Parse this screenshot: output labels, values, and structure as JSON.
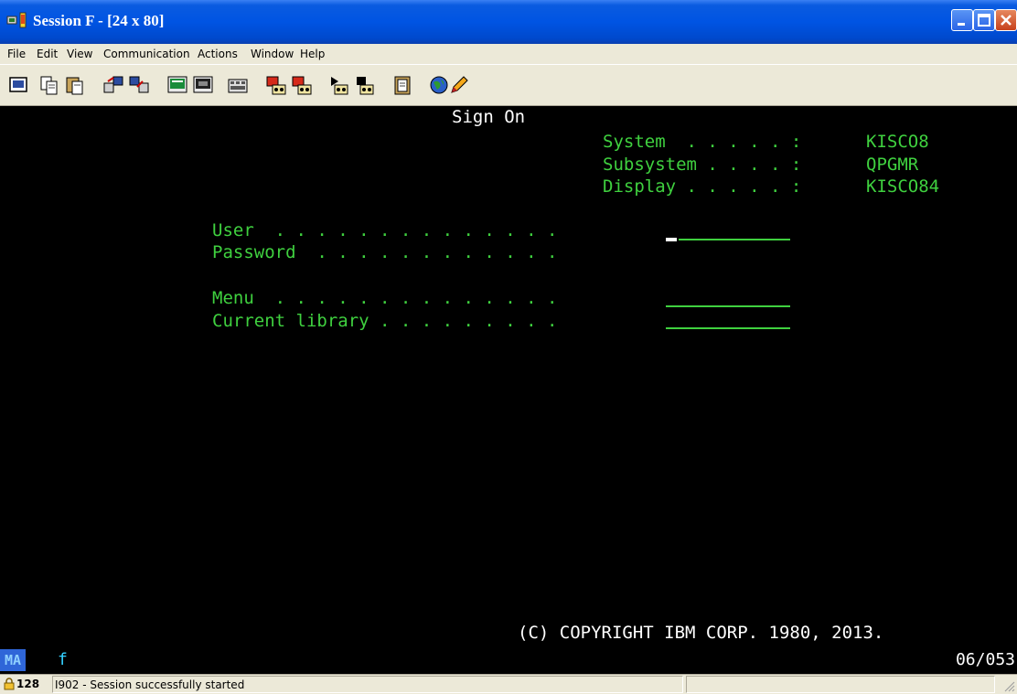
{
  "window": {
    "title": "Session F - [24 x 80]"
  },
  "menu": {
    "items": [
      "File",
      "Edit",
      "View",
      "Communication",
      "Actions",
      "Window",
      "Help"
    ]
  },
  "toolbar": {
    "icons": [
      "print-screen-icon",
      "copy-icon",
      "paste-icon",
      "send-icon",
      "receive-icon",
      "display-setup-icon",
      "keyboard-map-icon",
      "popup-keypad-icon",
      "record-macro-icon",
      "stop-macro-icon",
      "play-macro-icon",
      "macro-list-icon",
      "clipboard-icon",
      "globe-help-icon",
      "pencil-icon"
    ]
  },
  "screen": {
    "heading": "Sign On",
    "system_label": "System  . . . . . :",
    "system_value": "KISCO8",
    "subsystem_label": "Subsystem . . . . :",
    "subsystem_value": "QPGMR",
    "display_label": "Display . . . . . :",
    "display_value": "KISCO84",
    "user_label": "User  . . . . . . . . . . . . . .",
    "password_label": "Password  . . . . . . . . . . . .",
    "menu_label": "Menu  . . . . . . . . . . . . . .",
    "library_label": "Current library . . . . . . . . .",
    "copyright": "(C) COPYRIGHT IBM CORP. 1980, 2013."
  },
  "oia": {
    "mode": "MA",
    "indicator": "f",
    "cursor_position": "06/053"
  },
  "status": {
    "number": "128",
    "message": "I902 - Session successfully started"
  },
  "colors": {
    "terminal_green": "#3fd03f",
    "terminal_background": "#000000",
    "titlebar_blue": "#0054e3"
  }
}
